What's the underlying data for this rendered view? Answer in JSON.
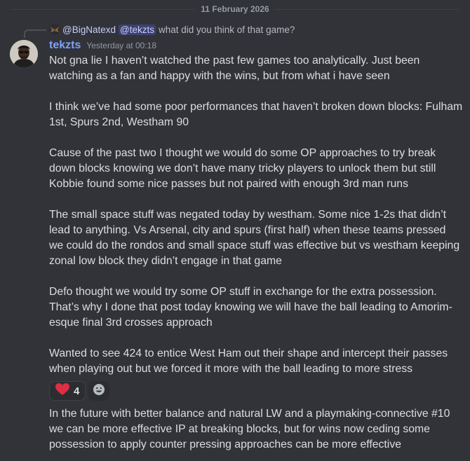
{
  "date_divider": "11 February 2026",
  "reply": {
    "author": "@BigNatexd",
    "mention": "@tekzts",
    "text": "what did you think of that game?"
  },
  "message": {
    "username": "tekzts",
    "timestamp": "Yesterday at 00:18",
    "paragraphs": [
      "Not gna lie I haven’t watched the past few games too analytically. Just been watching as a fan and happy with the wins, but from what i have seen",
      "I think we’ve had some poor performances that haven’t broken down blocks: Fulham 1st, Spurs 2nd, Westham 90",
      "Cause of the past two I thought we would do some OP approaches to try break down blocks knowing we don’t have many tricky players to unlock them but still Kobbie found some nice passes but not paired with enough 3rd man runs",
      "The small space stuff was negated today by westham. Some nice 1-2s that didn’t lead to anything. Vs Arsenal, city and spurs (first half) when these teams pressed we could do the rondos and small space stuff was effective but vs westham keeping zonal low block they didn’t engage in that game",
      "Defo thought we would try some OP stuff in exchange for the extra possession. That’s why I done that post today knowing we will have the ball leading to Amorim-esque final 3rd crosses approach",
      "Wanted to see 424 to entice West Ham out their shape and intercept their passes when playing out but we forced it more with the ball leading to more stress"
    ],
    "reactions": [
      {
        "icon": "heart-icon",
        "count": "4",
        "color": "#dd2e44"
      }
    ],
    "followup": "In the future with better balance and natural LW and a playmaking-connective #10 we can be more effective IP at breaking blocks, but for wins now ceding some possession to apply counter pressing approaches can be more effective"
  },
  "colors": {
    "background": "#313338",
    "username": "#7ea1ff",
    "mention_bg": "rgba(88,101,242,0.3)",
    "text": "#dbdee1",
    "muted": "#949ba4"
  }
}
